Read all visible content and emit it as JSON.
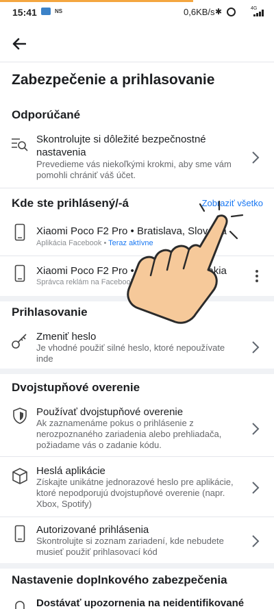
{
  "status_bar": {
    "time": "15:41",
    "carrier_badge": "NS",
    "speed": "0,6KB/s",
    "bluetooth": "✱",
    "network": "4G"
  },
  "header": {
    "title": "Zabezpečenie a prihlasovanie"
  },
  "recommended": {
    "heading": "Odporúčané",
    "item": {
      "title": "Skontrolujte si dôležité bezpečnostné nastavenia",
      "desc": "Prevedieme vás niekoľkými krokmi, aby sme vám pomohli chrániť váš účet."
    }
  },
  "where_logged_in": {
    "heading": "Kde ste prihlásený/-á",
    "see_all": "Zobraziť všetko",
    "sessions": [
      {
        "device": "Xiaomi Poco F2 Pro • Bratislava, Slovakia",
        "app": "Aplikácia Facebook • ",
        "status": "Teraz aktívne"
      },
      {
        "device": "Xiaomi Poco F2 Pro • Bratislava, Slovakia",
        "app": "Správca reklám na Facebooku",
        "status": ""
      }
    ]
  },
  "login": {
    "heading": "Prihlasovanie",
    "change_password": {
      "title": "Zmeniť heslo",
      "desc": "Je vhodné použiť silné heslo, ktoré nepoužívate inde"
    }
  },
  "two_factor": {
    "heading": "Dvojstupňové overenie",
    "items": [
      {
        "title": "Používať dvojstupňové overenie",
        "desc": "Ak zaznamenáme pokus o prihlásenie z nerozpoznaného zariadenia alebo prehliadača, požiadame vás o zadanie kódu."
      },
      {
        "title": "Heslá aplikácie",
        "desc": "Získajte unikátne jednorazové heslo pre aplikácie, ktoré nepodporujú dvojstupňové overenie (napr. Xbox, Spotify)"
      },
      {
        "title": "Autorizované prihlásenia",
        "desc": "Skontrolujte si zoznam zariadení, kde nebudete musieť použiť prihlasovací kód"
      }
    ]
  },
  "extra_security": {
    "heading": "Nastavenie doplnkového zabezpečenia",
    "partial_item": "Dostávať upozornenia na neidentifikované"
  },
  "colors": {
    "link_blue": "#1877f2",
    "hand_fill": "#f6c99a",
    "hand_stroke": "#2b2b2b"
  }
}
